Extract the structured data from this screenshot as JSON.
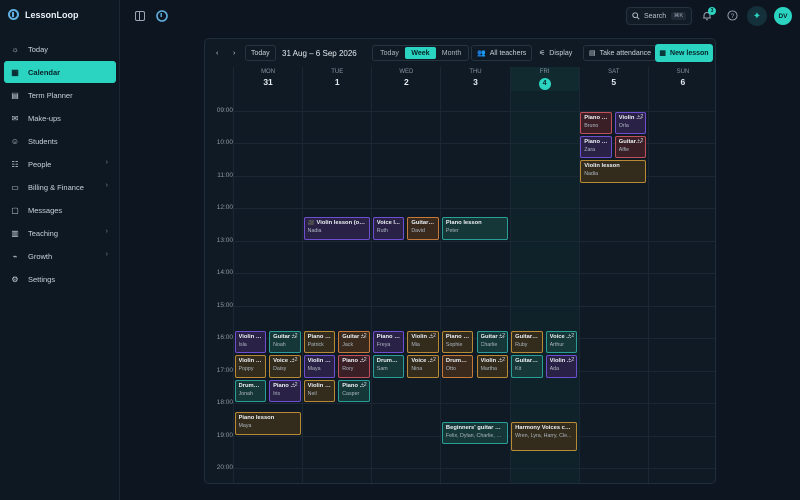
{
  "app": {
    "name": "LessonLoop"
  },
  "sidebar": {
    "items": [
      {
        "label": "Today",
        "icon": "sun-icon"
      },
      {
        "label": "Calendar",
        "icon": "calendar-icon",
        "active": true
      },
      {
        "label": "Term Planner",
        "icon": "planner-icon"
      },
      {
        "label": "Make-ups",
        "icon": "makeup-icon"
      },
      {
        "label": "Students",
        "icon": "students-icon"
      },
      {
        "label": "People",
        "icon": "people-icon",
        "chevron": true
      },
      {
        "label": "Billing & Finance",
        "icon": "billing-icon",
        "chevron": true
      },
      {
        "label": "Messages",
        "icon": "messages-icon"
      },
      {
        "label": "Teaching",
        "icon": "teaching-icon",
        "chevron": true
      },
      {
        "label": "Growth",
        "icon": "growth-icon",
        "chevron": true
      },
      {
        "label": "Settings",
        "icon": "settings-icon"
      }
    ]
  },
  "topbar": {
    "search_label": "Search",
    "search_shortcut": "⌘K",
    "notification_count": "3",
    "avatar_initials": "DV"
  },
  "toolbar": {
    "today_label": "Today",
    "date_range": "31 Aug – 6 Sep 2026",
    "views": [
      "Today",
      "Week",
      "Month"
    ],
    "active_view": "Week",
    "all_teachers_label": "All teachers",
    "display_label": "Display",
    "take_attendance_label": "Take attendance",
    "new_lesson_label": "New lesson"
  },
  "days": [
    {
      "dow": "MON",
      "num": "31"
    },
    {
      "dow": "TUE",
      "num": "1"
    },
    {
      "dow": "WED",
      "num": "2"
    },
    {
      "dow": "THU",
      "num": "3"
    },
    {
      "dow": "FRI",
      "num": "4",
      "today": true
    },
    {
      "dow": "SAT",
      "num": "5"
    },
    {
      "dow": "SUN",
      "num": "6"
    }
  ],
  "hours": [
    "09:00",
    "10:00",
    "11:00",
    "12:00",
    "13:00",
    "14:00",
    "15:00",
    "16:00",
    "17:00",
    "18:00",
    "19:00",
    "20:00"
  ],
  "events": [
    {
      "day": 5,
      "slot": 0,
      "start": 9.0,
      "end": 9.75,
      "title": "Piano l...",
      "sub": "Bruno",
      "color": "red"
    },
    {
      "day": 5,
      "slot": 1,
      "start": 9.0,
      "end": 9.75,
      "title": "Violin l...",
      "sub": "Orla",
      "color": "purple",
      "more": "+2"
    },
    {
      "day": 5,
      "slot": 0,
      "start": 9.75,
      "end": 10.5,
      "title": "Piano l...",
      "sub": "Zara",
      "color": "purple"
    },
    {
      "day": 5,
      "slot": 1,
      "start": 9.75,
      "end": 10.5,
      "title": "Guitar l...",
      "sub": "Alfie",
      "color": "red",
      "more": "+2"
    },
    {
      "day": 5,
      "slot": 0,
      "start": 10.5,
      "end": 11.25,
      "title": "Violin lesson",
      "sub": "Nadia",
      "color": "gold",
      "wide": true
    },
    {
      "day": 1,
      "slot": 0,
      "start": 12.25,
      "end": 13.0,
      "title": "🎥 Violin lesson (onlin...",
      "sub": "Nadia",
      "color": "purple",
      "wide": true
    },
    {
      "day": 2,
      "slot": 0,
      "start": 12.25,
      "end": 13.0,
      "title": "Voice l...",
      "sub": "Ruth",
      "color": "purple"
    },
    {
      "day": 2,
      "slot": 1,
      "start": 12.25,
      "end": 13.0,
      "title": "Guitar l...",
      "sub": "David",
      "color": "orange"
    },
    {
      "day": 3,
      "slot": 0,
      "start": 12.25,
      "end": 13.0,
      "title": "Piano lesson",
      "sub": "Peter",
      "color": "teal",
      "wide": true
    },
    {
      "day": 0,
      "slot": 0,
      "start": 15.75,
      "end": 16.5,
      "title": "Violin l...",
      "sub": "Isla",
      "color": "purple"
    },
    {
      "day": 0,
      "slot": 1,
      "start": 15.75,
      "end": 16.5,
      "title": "Guitar ...",
      "sub": "Noah",
      "color": "teal",
      "more": "+2"
    },
    {
      "day": 1,
      "slot": 0,
      "start": 15.75,
      "end": 16.5,
      "title": "Piano l...",
      "sub": "Patrick",
      "color": "gold"
    },
    {
      "day": 1,
      "slot": 1,
      "start": 15.75,
      "end": 16.5,
      "title": "Guitar ...",
      "sub": "Jack",
      "color": "orange",
      "more": "+2"
    },
    {
      "day": 2,
      "slot": 0,
      "start": 15.75,
      "end": 16.5,
      "title": "Piano l...",
      "sub": "Freya",
      "color": "purple"
    },
    {
      "day": 2,
      "slot": 1,
      "start": 15.75,
      "end": 16.5,
      "title": "Violin ...",
      "sub": "Mia",
      "color": "gold",
      "more": "+2"
    },
    {
      "day": 3,
      "slot": 0,
      "start": 15.75,
      "end": 16.5,
      "title": "Piano l...",
      "sub": "Sophie",
      "color": "gold"
    },
    {
      "day": 3,
      "slot": 1,
      "start": 15.75,
      "end": 16.5,
      "title": "Guitar ...",
      "sub": "Charlie",
      "color": "teal",
      "more": "+2"
    },
    {
      "day": 4,
      "slot": 0,
      "start": 15.75,
      "end": 16.5,
      "title": "Guitar l...",
      "sub": "Ruby",
      "color": "gold"
    },
    {
      "day": 4,
      "slot": 1,
      "start": 15.75,
      "end": 16.5,
      "title": "Voice ...",
      "sub": "Arthur",
      "color": "teal",
      "more": "+2"
    },
    {
      "day": 0,
      "slot": 0,
      "start": 16.5,
      "end": 17.25,
      "title": "Violin l...",
      "sub": "Poppy",
      "color": "gold"
    },
    {
      "day": 0,
      "slot": 1,
      "start": 16.5,
      "end": 17.25,
      "title": "Voice ...",
      "sub": "Daisy",
      "color": "gold",
      "more": "+2"
    },
    {
      "day": 1,
      "slot": 0,
      "start": 16.5,
      "end": 17.25,
      "title": "Violin l...",
      "sub": "Maya",
      "color": "purple"
    },
    {
      "day": 1,
      "slot": 1,
      "start": 16.5,
      "end": 17.25,
      "title": "Piano ...",
      "sub": "Rory",
      "color": "red",
      "more": "+2"
    },
    {
      "day": 2,
      "slot": 0,
      "start": 16.5,
      "end": 17.25,
      "title": "Drums l...",
      "sub": "Sam",
      "color": "teal"
    },
    {
      "day": 2,
      "slot": 1,
      "start": 16.5,
      "end": 17.25,
      "title": "Voice ...",
      "sub": "Nina",
      "color": "gold",
      "more": "+2"
    },
    {
      "day": 3,
      "slot": 0,
      "start": 16.5,
      "end": 17.25,
      "title": "Drums l...",
      "sub": "Otto",
      "color": "orange"
    },
    {
      "day": 3,
      "slot": 1,
      "start": 16.5,
      "end": 17.25,
      "title": "Violin ...",
      "sub": "Martha",
      "color": "gold",
      "more": "+2"
    },
    {
      "day": 4,
      "slot": 0,
      "start": 16.5,
      "end": 17.25,
      "title": "Guitar l...",
      "sub": "Kit",
      "color": "teal"
    },
    {
      "day": 4,
      "slot": 1,
      "start": 16.5,
      "end": 17.25,
      "title": "Violin ...",
      "sub": "Ada",
      "color": "purple",
      "more": "+2"
    },
    {
      "day": 0,
      "slot": 0,
      "start": 17.25,
      "end": 18.0,
      "title": "Drums l...",
      "sub": "Jonah",
      "color": "teal"
    },
    {
      "day": 0,
      "slot": 1,
      "start": 17.25,
      "end": 18.0,
      "title": "Piano ...",
      "sub": "Iris",
      "color": "purple",
      "more": "+2"
    },
    {
      "day": 1,
      "slot": 0,
      "start": 17.25,
      "end": 18.0,
      "title": "Violin l...",
      "sub": "Neil",
      "color": "gold"
    },
    {
      "day": 1,
      "slot": 1,
      "start": 17.25,
      "end": 18.0,
      "title": "Piano ...",
      "sub": "Casper",
      "color": "teal",
      "more": "+2"
    },
    {
      "day": 0,
      "slot": 0,
      "start": 18.25,
      "end": 19.0,
      "title": "Piano lesson",
      "sub": "Maya",
      "color": "gold",
      "wide": true
    },
    {
      "day": 3,
      "slot": 0,
      "start": 18.55,
      "end": 19.3,
      "title": "Beginners' guitar gro...",
      "sub": "Felix, Dylan, Charlie, K...",
      "color": "teal",
      "wide": true
    },
    {
      "day": 4,
      "slot": 0,
      "start": 18.55,
      "end": 19.5,
      "title": "Harmony Voices choir",
      "sub": "Wren, Lyra, Harry, Cle...",
      "color": "gold",
      "wide": true
    }
  ]
}
